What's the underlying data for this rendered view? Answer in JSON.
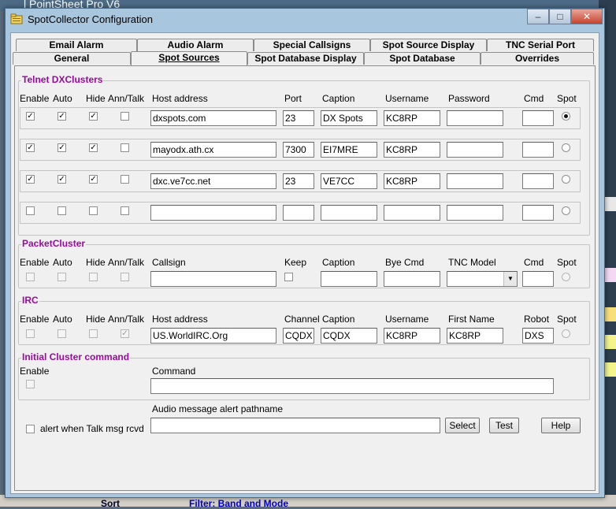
{
  "background_app": {
    "title_fragment": "l PointSheet Pro V6",
    "sort_label": "Sort",
    "filter_label": "Filter: Band and Mode"
  },
  "window": {
    "title": "SpotCollector Configuration",
    "min_glyph": "–",
    "max_glyph": "□",
    "close_glyph": "✕"
  },
  "tabs": {
    "row_back": [
      "Email Alarm",
      "Audio Alarm",
      "Special Callsigns",
      "Spot Source Display",
      "TNC Serial Port"
    ],
    "row_front": [
      "General",
      "Spot Sources",
      "Spot Database Display",
      "Spot Database",
      "Overrides"
    ],
    "active": "Spot Sources"
  },
  "telnet": {
    "title": "Telnet DXClusters",
    "headers": {
      "enable": "Enable",
      "auto": "Auto",
      "hide": "Hide",
      "anntalk": "Ann/Talk",
      "host": "Host address",
      "port": "Port",
      "caption": "Caption",
      "username": "Username",
      "password": "Password",
      "cmd": "Cmd",
      "spot": "Spot"
    },
    "rows": [
      {
        "enable": true,
        "auto": true,
        "hide": true,
        "anntalk": false,
        "host": "dxspots.com",
        "port": "23",
        "caption": "DX Spots",
        "username": "KC8RP",
        "password": "",
        "cmd": "",
        "spot": true
      },
      {
        "enable": true,
        "auto": true,
        "hide": true,
        "anntalk": false,
        "host": "mayodx.ath.cx",
        "port": "7300",
        "caption": "EI7MRE",
        "username": "KC8RP",
        "password": "",
        "cmd": "",
        "spot": false
      },
      {
        "enable": true,
        "auto": true,
        "hide": true,
        "anntalk": false,
        "host": "dxc.ve7cc.net",
        "port": "23",
        "caption": "VE7CC",
        "username": "KC8RP",
        "password": "",
        "cmd": "",
        "spot": false
      },
      {
        "enable": false,
        "auto": false,
        "hide": false,
        "anntalk": false,
        "host": "",
        "port": "",
        "caption": "",
        "username": "",
        "password": "",
        "cmd": "",
        "spot": false
      }
    ]
  },
  "packet": {
    "title": "PacketCluster",
    "headers": {
      "enable": "Enable",
      "auto": "Auto",
      "hide": "Hide",
      "anntalk": "Ann/Talk",
      "callsign": "Callsign",
      "keep": "Keep",
      "caption": "Caption",
      "bye": "Bye Cmd",
      "tnc": "TNC Model",
      "cmd": "Cmd",
      "spot": "Spot"
    },
    "values": {
      "callsign": "",
      "caption": "",
      "bye": "",
      "tnc": "",
      "cmd": ""
    }
  },
  "irc": {
    "title": "IRC",
    "headers": {
      "enable": "Enable",
      "auto": "Auto",
      "hide": "Hide",
      "anntalk": "Ann/Talk",
      "host": "Host address",
      "channel": "Channel",
      "caption": "Caption",
      "username": "Username",
      "firstname": "First Name",
      "robot": "Robot",
      "spot": "Spot"
    },
    "values": {
      "host": "US.WorldIRC.Org",
      "channel": "CQDX",
      "caption": "CQDX",
      "username": "KC8RP",
      "firstname": "KC8RP",
      "robot": "DXS"
    }
  },
  "initial": {
    "title": "Initial Cluster command",
    "enable_label": "Enable",
    "command_label": "Command",
    "command_value": ""
  },
  "alert": {
    "talk_label": "alert when Talk msg rcvd",
    "audio_label": "Audio message alert pathname",
    "audio_value": "",
    "select_label": "Select",
    "test_label": "Test",
    "help_label": "Help"
  },
  "colors": {
    "group_title": "#9b0aa0",
    "window_frame": "#a9c6df",
    "close_button": "#c7432d"
  }
}
